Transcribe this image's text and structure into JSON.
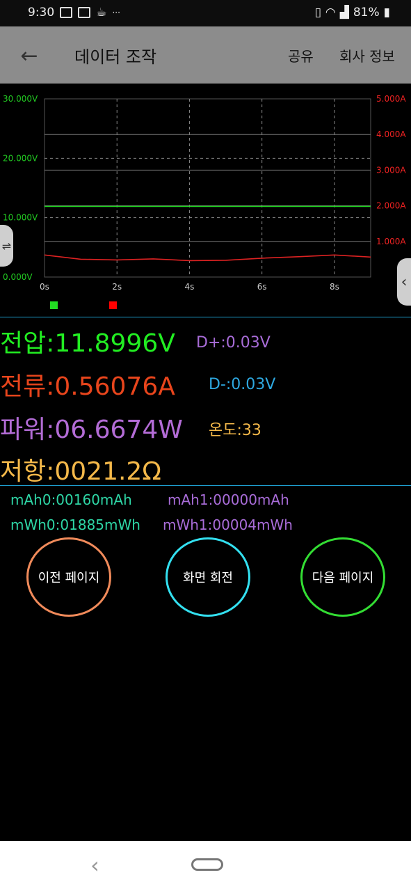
{
  "status_bar": {
    "time": "9:30",
    "dots": "···",
    "battery": "81%"
  },
  "app_bar": {
    "back_icon": "arrow-left-icon",
    "title": "데이터 조작",
    "share": "공유",
    "about": "회사 정보"
  },
  "chart_data": {
    "type": "line",
    "x": [
      0,
      1,
      2,
      3,
      4,
      5,
      6,
      7,
      8,
      9
    ],
    "x_ticks": [
      "0s",
      "2s",
      "4s",
      "6s",
      "8s"
    ],
    "y_left_ticks": [
      "30.000V",
      "20.000V",
      "10.000V",
      "0.000V"
    ],
    "y_right_ticks": [
      "5.000A",
      "4.000A",
      "3.000A",
      "2.000A",
      "1.000A"
    ],
    "ylim_left": [
      0,
      30
    ],
    "ylim_right": [
      0,
      5
    ],
    "series": [
      {
        "color": "#22dd22",
        "axis": "left",
        "values": [
          11.9,
          11.9,
          11.9,
          11.9,
          11.9,
          11.9,
          11.9,
          11.9,
          11.9,
          11.9
        ]
      },
      {
        "color": "#dd2222",
        "axis": "right",
        "values": [
          0.62,
          0.5,
          0.48,
          0.51,
          0.46,
          0.47,
          0.53,
          0.57,
          0.62,
          0.56
        ]
      }
    ],
    "legend_colors": [
      "#22dd22",
      "#ff0000"
    ]
  },
  "readings": {
    "voltage": "전압:11.8996V",
    "d_plus": "D+:0.03V",
    "current": "전류:0.56076A",
    "d_minus": "D-:0.03V",
    "power": "파워:06.6674W",
    "temperature": "온도:33",
    "resistance": "저항:0021.2Ω"
  },
  "counters": {
    "mah0": "mAh0:00160mAh",
    "mah1": "mAh1:00000mAh",
    "mwh0": "mWh0:01885mWh",
    "mwh1": "mWh1:00004mWh"
  },
  "buttons": {
    "prev": "이전 페이지",
    "rotate": "화면 회전",
    "next": "다음 페이지"
  },
  "colors": {
    "voltage": "#22ee22",
    "current": "#e8451c",
    "power": "#b36cd6",
    "resistance": "#f5b94a",
    "d_plus": "#a86cd8",
    "d_minus": "#2ea8e0",
    "temperature": "#f5b94a",
    "counter_left": "#2ed6a6",
    "counter_right": "#a86cd8",
    "prev_border": "#f08a5a",
    "rotate_border": "#33e0f0",
    "next_border": "#33dd33"
  }
}
